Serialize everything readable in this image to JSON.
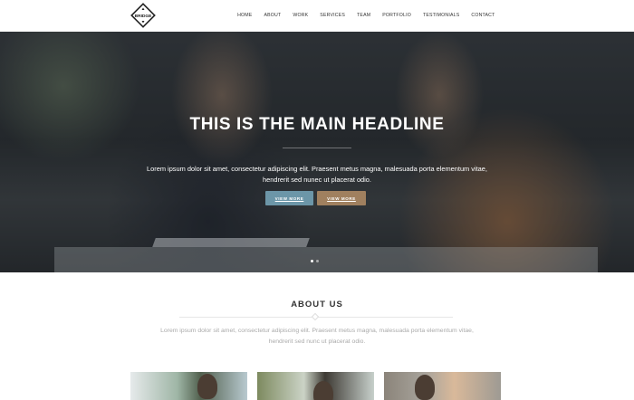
{
  "brand": {
    "logo_text": "BRIDGE"
  },
  "nav": {
    "items": [
      "HOME",
      "ABOUT",
      "WORK",
      "SERVICES",
      "TEAM",
      "PORTFOLIO",
      "TESTIMONIALS",
      "CONTACT"
    ]
  },
  "hero": {
    "headline": "THIS IS THE MAIN HEADLINE",
    "lead": "Lorem ipsum dolor sit amet, consectetur adipiscing elit. Praesent metus magna, malesuada porta elementum vitae, hendrerit sed nunec ut placerat odio.",
    "button1": "VIEW MORE",
    "button2": "VIEW MORE",
    "slides": {
      "count": 2,
      "active": 1
    },
    "colors": {
      "button1_bg": "#6c96a8",
      "button2_bg": "#a0805f"
    }
  },
  "about": {
    "title": "ABOUT US",
    "text": "Lorem ipsum dolor sit amet, consectetur adipiscing elit. Praesent metus magna, malesuada porta elementum vitae, hendrerit sed nunc ut placerat odio."
  }
}
